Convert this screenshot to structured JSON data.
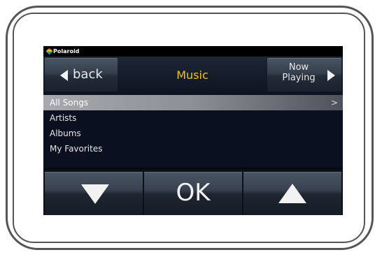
{
  "brand": {
    "name": "Polaroid"
  },
  "header": {
    "back_label": "back",
    "title": "Music",
    "now_playing_line1": "Now",
    "now_playing_line2": "Playing"
  },
  "list": {
    "items": [
      {
        "label": "All Songs",
        "selected": true,
        "chevron": ">"
      },
      {
        "label": "Artists"
      },
      {
        "label": "Albums"
      },
      {
        "label": "My Favorites"
      }
    ]
  },
  "footer": {
    "down_icon": "triangle-down",
    "ok_label": "OK",
    "up_icon": "triangle-up"
  },
  "colors": {
    "title": "#f3c21a",
    "selected_row": "#a7a9ad",
    "screen_bg": "#05070c"
  }
}
